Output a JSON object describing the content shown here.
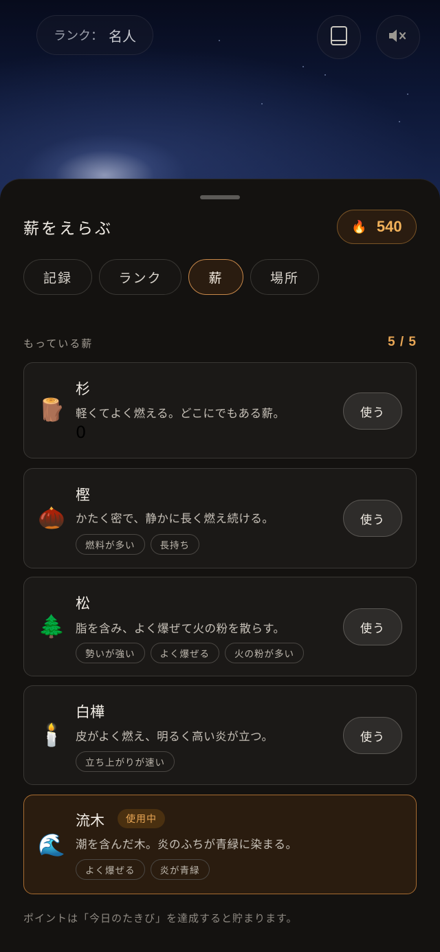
{
  "header": {
    "rank_label": "ランク：",
    "rank_value": "名人",
    "book_icon": "book-icon",
    "mute_icon": "speaker-mute-icon"
  },
  "sheet": {
    "title": "薪をえらぶ",
    "points": {
      "icon": "fire-icon",
      "value": "540"
    },
    "tabs": [
      {
        "label": "記録",
        "active": false
      },
      {
        "label": "ランク",
        "active": false
      },
      {
        "label": "薪",
        "active": true
      },
      {
        "label": "場所",
        "active": false
      }
    ],
    "owned_label": "もっている薪",
    "owned_count": "5 / 5",
    "woods": [
      {
        "icon": "log-icon",
        "emoji": "🪵",
        "name": "杉",
        "desc": "軽くてよく燃える。どこにでもある薪。",
        "extra": "0",
        "tags": [],
        "button": "使う"
      },
      {
        "icon": "chestnut-icon",
        "emoji": "🌰",
        "name": "樫",
        "desc": "かたく密で、静かに長く燃え続ける。",
        "tags": [
          "燃料が多い",
          "長持ち"
        ],
        "button": "使う"
      },
      {
        "icon": "pine-tree-icon",
        "emoji": "🌲",
        "name": "松",
        "desc": "脂を含み、よく爆ぜて火の粉を散らす。",
        "tags": [
          "勢いが強い",
          "よく爆ぜる",
          "火の粉が多い"
        ],
        "button": "使う"
      },
      {
        "icon": "candle-icon",
        "emoji": "🕯️",
        "name": "白樺",
        "desc": "皮がよく燃え、明るく高い炎が立つ。",
        "tags": [
          "立ち上がりが速い"
        ],
        "button": "使う"
      },
      {
        "icon": "wave-icon",
        "emoji": "🌊",
        "name": "流木",
        "badge": "使用中",
        "desc": "潮を含んだ木。炎のふちが青緑に染まる。",
        "tags": [
          "よく爆ぜる",
          "炎が青緑"
        ]
      }
    ],
    "footer_note": "ポイントは「今日のたきび」を達成すると貯まります。"
  },
  "colors": {
    "accent": "#e8a655",
    "active_border": "#c9894a",
    "sheet_bg": "#141210",
    "card_bg": "#1b1917"
  }
}
